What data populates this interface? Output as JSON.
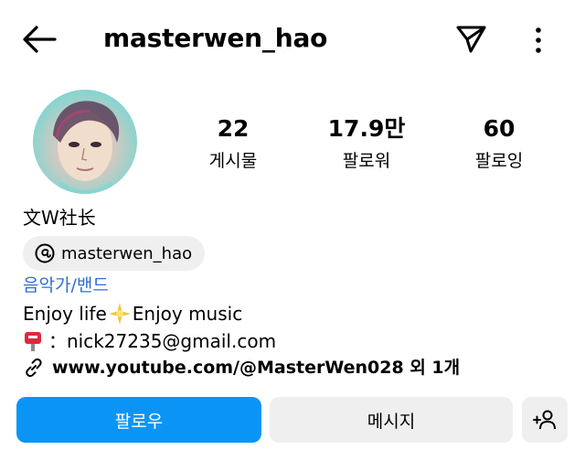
{
  "header": {
    "username": "masterwen_hao",
    "back_icon": "arrow-left-icon",
    "send_icon": "paper-plane-icon",
    "more_icon": "more-vertical-icon"
  },
  "stats": [
    {
      "value": "22",
      "label": "게시물"
    },
    {
      "value": "17.9만",
      "label": "팔로워"
    },
    {
      "value": "60",
      "label": "팔로잉"
    }
  ],
  "profile": {
    "display_name": "文W社长",
    "threads_handle": "masterwen_hao",
    "category": "음악가/밴드",
    "bio_line1_a": "Enjoy life",
    "bio_line1_b": "Enjoy music",
    "bio_line2": "：nick27235@gmail.com",
    "link_text": "www.youtube.com/@MasterWen028 외 1개"
  },
  "buttons": {
    "follow": "팔로우",
    "message": "메시지"
  },
  "colors": {
    "primary": "#0a95f6",
    "secondary_bg": "#efefef",
    "category": "#2f6fd1"
  }
}
